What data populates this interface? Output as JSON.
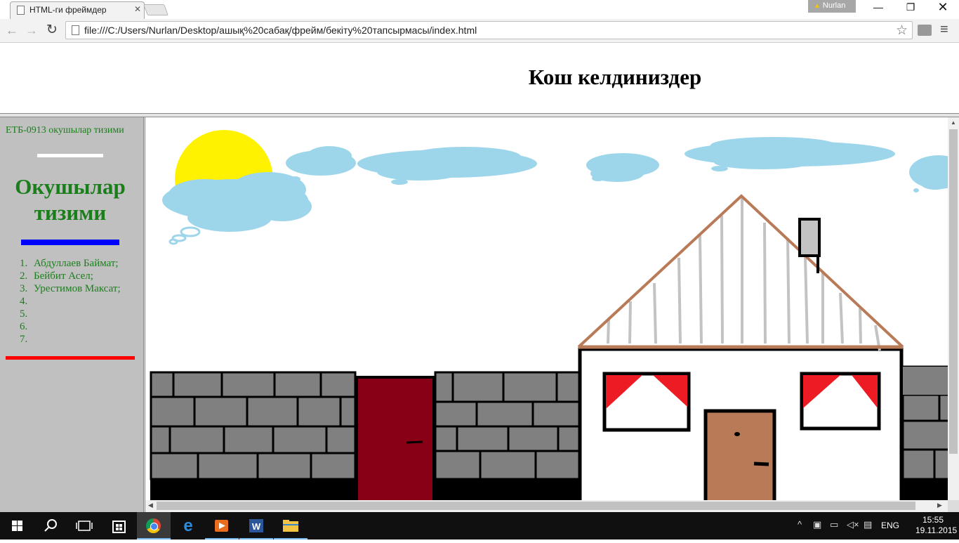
{
  "browser": {
    "tab_title": "HTML-ги фреймдер",
    "tab_close": "✕",
    "profile_name": "Nurlan",
    "url": "file:///C:/Users/Nurlan/Desktop/ашық%20сабақ/фрейм/бекіту%20тапсырмасы/index.html",
    "window_min": "—",
    "window_max": "❐",
    "window_close": "✕",
    "back_glyph": "←",
    "forward_glyph": "→",
    "reload_glyph": "↻",
    "star_glyph": "☆",
    "menu_glyph": "≡"
  },
  "top_frame": {
    "heading": "Кош келдиниздер"
  },
  "left_frame": {
    "group_label": "ЕТБ-0913 окушылар тизими",
    "list_heading": "Окушылар тизими",
    "students": [
      {
        "num": "1.",
        "name": "Абдуллаев Баймат;"
      },
      {
        "num": "2.",
        "name": "Бейбит Асел;"
      },
      {
        "num": "3.",
        "name": "Урестимов Максат;"
      },
      {
        "num": "4.",
        "name": ""
      },
      {
        "num": "5.",
        "name": ""
      },
      {
        "num": "6.",
        "name": ""
      },
      {
        "num": "7.",
        "name": ""
      }
    ],
    "colors": {
      "text": "#1a7f1a",
      "background": "#c0c0c0",
      "hr_white": "#ffffff",
      "hr_blue": "#0000ff",
      "hr_red": "#ff0000"
    }
  },
  "main_frame": {
    "picture_colors": {
      "sky_cloud": "#9dd6ea",
      "sun": "#fff200",
      "wall_brick": "#808080",
      "gate": "#880015",
      "roof_edge": "#b97a57",
      "house_door": "#b97a57",
      "curtain": "#ed1c24"
    }
  },
  "taskbar": {
    "lang": "ENG",
    "time": "15:55",
    "date": "19.11.2015"
  }
}
